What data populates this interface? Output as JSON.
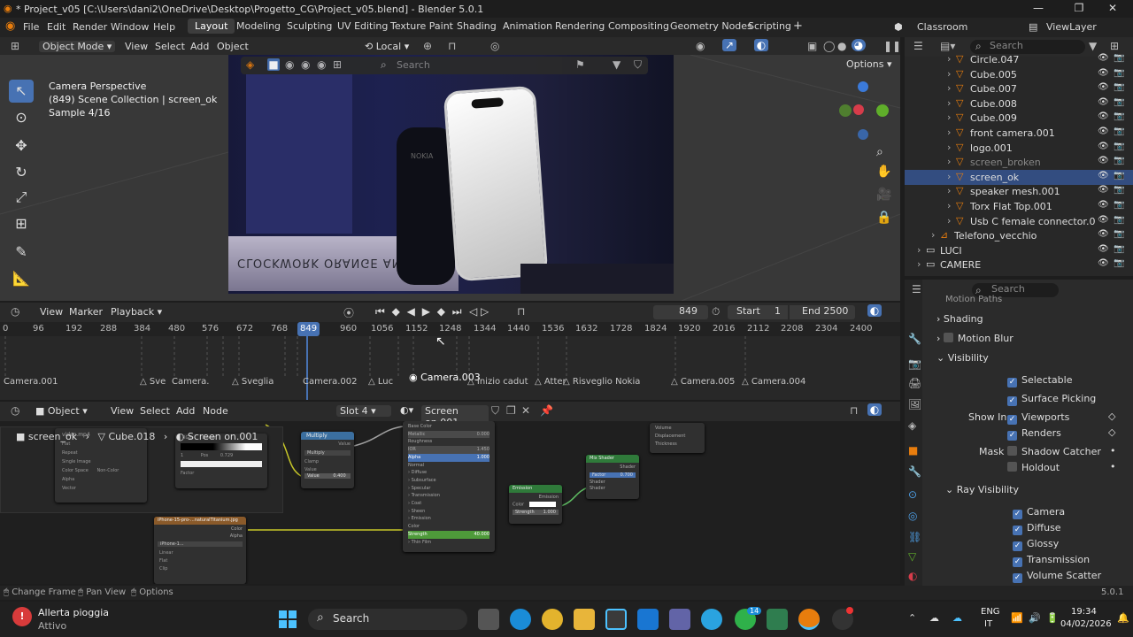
{
  "title": "* Project_v05 [C:\\Users\\dani2\\OneDrive\\Desktop\\Progetto_CG\\Project_v05.blend] - Blender 5.0.1",
  "menu": [
    "File",
    "Edit",
    "Render",
    "Window",
    "Help"
  ],
  "workspaces": [
    "Layout",
    "Modeling",
    "Sculpting",
    "UV Editing",
    "Texture Paint",
    "Shading",
    "Animation",
    "Rendering",
    "Compositing",
    "Geometry Nodes",
    "Scripting"
  ],
  "scene": "Classroom",
  "view_layer": "ViewLayer",
  "search_placeholder": "Search",
  "viewport": {
    "mode": "Object Mode",
    "view": "View",
    "select": "Select",
    "add": "Add",
    "object": "Object",
    "orientation": "Local",
    "options": "Options",
    "search": "Search",
    "info1": "Camera Perspective",
    "info2": "(849) Scene Collection | screen_ok",
    "info3": "Sample 4/16",
    "book_text": "CLOCKWORK ORANGE ANTHONYBURGESS",
    "phone_brand": "NOKIA"
  },
  "timeline": {
    "view": "View",
    "marker": "Marker",
    "playback": "Playback",
    "frame": "849",
    "start_label": "Start",
    "start": "1",
    "end_label": "End",
    "end": "2500",
    "ticks": [
      "0",
      "96",
      "192",
      "288",
      "384",
      "480",
      "576",
      "672",
      "768",
      "849",
      "960",
      "1056",
      "1152",
      "1248",
      "1344",
      "1440",
      "1536",
      "1632",
      "1728",
      "1824",
      "1920",
      "2016",
      "2112",
      "2208",
      "2304",
      "2400"
    ],
    "markers": [
      "Camera.001",
      "Sve",
      "Camera.",
      "Sveglia",
      "Camera.002",
      "Luc",
      "Camera.003",
      "Inizio cadut",
      "Atter",
      "Risveglio Nokia",
      "Camera.005",
      "Camera.004"
    ]
  },
  "node_editor": {
    "type": "Object",
    "view": "View",
    "select": "Select",
    "add": "Add",
    "node": "Node",
    "slot": "Slot 4",
    "material": "Screen on.001",
    "breadcrumb": [
      "screen_ok",
      "Cube.018",
      "Screen on.001"
    ],
    "nodes": {
      "multiply_title": "Multiply",
      "multiply_value": "Value",
      "multiply_op": "Multiply",
      "multiply_clamp": "Clamp",
      "multiply_val": "Value",
      "multiply_num": "0.400",
      "bsdf_rows": [
        "Base Color",
        "Metallic",
        "Roughness",
        "IOR",
        "Alpha",
        "Normal",
        "Diffuse",
        "Subsurface",
        "Specular",
        "Transmission",
        "Coat",
        "Sheen",
        "Emission",
        "Color",
        "Strength",
        "Thin Film"
      ],
      "bsdf_metallic": "0.000",
      "bsdf_ior": "1.450",
      "bsdf_alpha": "1.000",
      "bsdf_strength": "40.000",
      "emission_title": "Emission",
      "emission_out": "Emission",
      "emission_color": "Color",
      "emission_strength": "Strength",
      "emission_strength_val": "1.000",
      "mix_title": "Mix Shader",
      "mix_shader": "Shader",
      "mix_factor": "Factor",
      "mix_factor_val": "0.700",
      "mix_shader_in1": "Shader",
      "mix_shader_in2": "Shader",
      "output_rows": [
        "Volume",
        "Displacement",
        "Thickness"
      ],
      "image_title": "iPhone-15-pro-...naturalTitanium.jpg",
      "image_color": "Color",
      "image_alpha": "Alpha",
      "image_name": "iPhone-1...",
      "image_opts": [
        "Linear",
        "Flat",
        "Clip"
      ],
      "video_name": "video.mp4",
      "video_opts": [
        "Flat",
        "Repeat",
        "Single Image"
      ],
      "color_space": "Color Space",
      "color_space_val": "Non-Color",
      "alpha": "Alpha",
      "vector": "Vector",
      "ramp_mode": "RGB",
      "ramp_interp": "Linear",
      "ramp_num": "1",
      "ramp_pos": "Pos",
      "ramp_pos_val": "0.729",
      "ramp_factor": "Factor",
      "ramp_color": "Color",
      "ramp_alpha": "Alpha"
    }
  },
  "outliner": [
    {
      "name": "Circle.047",
      "indent": 1
    },
    {
      "name": "Cube.005",
      "indent": 1
    },
    {
      "name": "Cube.007",
      "indent": 1
    },
    {
      "name": "Cube.008",
      "indent": 1
    },
    {
      "name": "Cube.009",
      "indent": 1
    },
    {
      "name": "front camera.001",
      "indent": 1
    },
    {
      "name": "logo.001",
      "indent": 1
    },
    {
      "name": "screen_broken",
      "indent": 1,
      "dim": true
    },
    {
      "name": "screen_ok",
      "indent": 1,
      "selected": true
    },
    {
      "name": "speaker mesh.001",
      "indent": 1
    },
    {
      "name": "Torx Flat Top.001",
      "indent": 1
    },
    {
      "name": "Usb C female connector.0",
      "indent": 1
    },
    {
      "name": "Telefono_vecchio",
      "indent": 0
    },
    {
      "name": "LUCI",
      "indent": -1
    },
    {
      "name": "CAMERE",
      "indent": -1
    }
  ],
  "properties": {
    "search": "Search",
    "partial": "Motion Paths",
    "shading": "Shading",
    "motion_blur": "Motion Blur",
    "visibility": "Visibility",
    "selectable": "Selectable",
    "surface_picking": "Surface Picking",
    "show_in": "Show In",
    "viewports": "Viewports",
    "renders": "Renders",
    "mask": "Mask",
    "shadow_catcher": "Shadow Catcher",
    "holdout": "Holdout",
    "ray_visibility": "Ray Visibility",
    "ray": [
      "Camera",
      "Diffuse",
      "Glossy",
      "Transmission",
      "Volume Scatter"
    ]
  },
  "statusbar": {
    "change_frame": "Change Frame",
    "pan_view": "Pan View",
    "options": "Options",
    "version": "5.0.1"
  },
  "taskbar": {
    "weather_title": "Allerta pioggia",
    "weather_sub": "Attivo",
    "search": "Search",
    "lang1": "ENG",
    "lang2": "IT",
    "time": "19:34",
    "date": "04/02/2026",
    "badge": "14"
  }
}
